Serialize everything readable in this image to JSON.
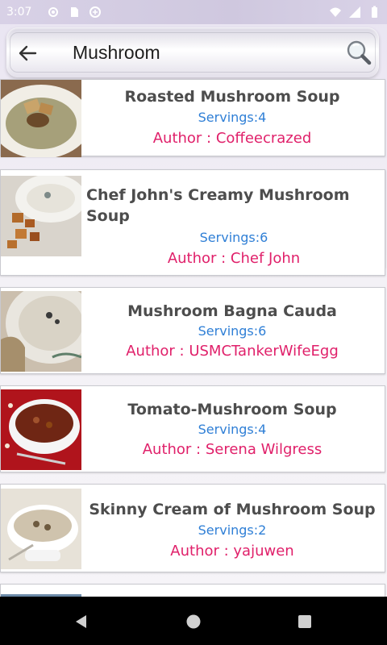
{
  "status_bar": {
    "time": "3:07",
    "icons": [
      "settings-icon",
      "sim-icon",
      "data-saver-icon",
      "wifi-icon",
      "signal-icon",
      "battery-icon"
    ]
  },
  "search": {
    "query": "Mushroom",
    "back_icon": "arrow-left-icon",
    "search_icon": "magnifier-icon"
  },
  "recipes": [
    {
      "title": "Roasted Mushroom Soup",
      "servings": "Servings:4",
      "author": "Author : Coffeecrazed"
    },
    {
      "title": "Chef John's Creamy Mushroom Soup",
      "servings": "Servings:6",
      "author": "Author : Chef John"
    },
    {
      "title": "Mushroom Bagna Cauda",
      "servings": "Servings:6",
      "author": "Author : USMCTankerWifeEgg"
    },
    {
      "title": "Tomato-Mushroom Soup",
      "servings": "Servings:4",
      "author": "Author : Serena Wilgress"
    },
    {
      "title": "Skinny Cream of Mushroom Soup",
      "servings": "Servings:2",
      "author": "Author : yajuwen"
    }
  ],
  "colors": {
    "title": "#4d4d4d",
    "servings": "#2f7fd6",
    "author": "#e0206a",
    "nav_bar": "#000000"
  },
  "nav_bar": {
    "icons": [
      "back-triangle-icon",
      "home-circle-icon",
      "recents-square-icon"
    ]
  }
}
